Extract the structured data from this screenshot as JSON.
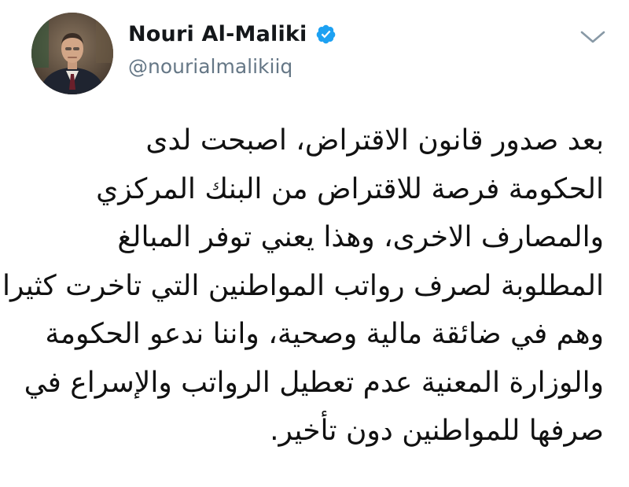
{
  "author": {
    "display_name": "Nouri Al-Maliki",
    "handle": "@nourialmalikiiq",
    "verified": true,
    "avatar_icon": "profile-photo"
  },
  "menu": {
    "icon": "chevron-down-icon"
  },
  "tweet": {
    "lines": [
      "بعد صدور قانون الاقتراض، اصبحت لدى",
      "الحكومة فرصة للاقتراض من البنك المركزي",
      "والمصارف الاخرى، وهذا يعني توفر المبالغ",
      "المطلوبة لصرف رواتب المواطنين التي تاخرت كثيرا",
      "وهم في ضائقة مالية وصحية، واننا ندعو الحكومة",
      "والوزارة المعنية عدم تعطيل الرواتب والإسراع في",
      "صرفها للمواطنين دون تأخير."
    ]
  },
  "colors": {
    "verified_badge": "#1da1f2",
    "handle": "#657786",
    "text": "#111111",
    "chevron": "#8899a6"
  }
}
